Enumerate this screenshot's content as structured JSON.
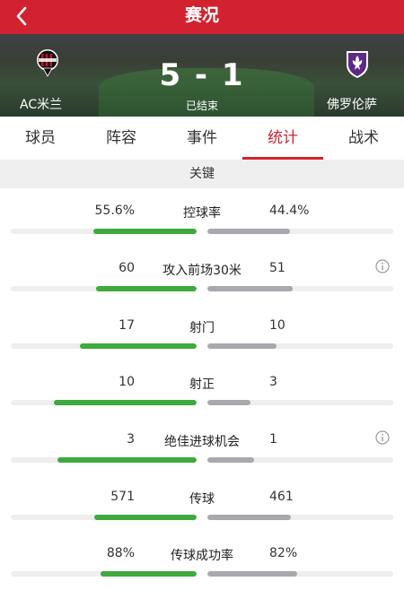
{
  "topbar": {
    "title": "赛况",
    "back_icon": "chevron-left-icon"
  },
  "match": {
    "home_team": "AC米兰",
    "away_team": "佛罗伦萨",
    "score": "5 - 1",
    "status": "已结束",
    "home_logo": "ac-milan-crest-icon",
    "away_logo": "fiorentina-crest-icon"
  },
  "tabs": [
    {
      "label": "球员"
    },
    {
      "label": "阵容"
    },
    {
      "label": "事件"
    },
    {
      "label": "统计",
      "active": true
    },
    {
      "label": "战术"
    }
  ],
  "section": {
    "title": "关键"
  },
  "stats": [
    {
      "label": "控球率",
      "home": "55.6%",
      "away": "44.4%",
      "home_ratio": 0.556,
      "away_ratio": 0.444,
      "info": false
    },
    {
      "label": "攻入前场30米",
      "home": "60",
      "away": "51",
      "home_ratio": 0.54,
      "away_ratio": 0.46,
      "info": true
    },
    {
      "label": "射门",
      "home": "17",
      "away": "10",
      "home_ratio": 0.63,
      "away_ratio": 0.37,
      "info": false
    },
    {
      "label": "射正",
      "home": "10",
      "away": "3",
      "home_ratio": 0.77,
      "away_ratio": 0.23,
      "info": false
    },
    {
      "label": "绝佳进球机会",
      "home": "3",
      "away": "1",
      "home_ratio": 0.75,
      "away_ratio": 0.25,
      "info": true
    },
    {
      "label": "传球",
      "home": "571",
      "away": "461",
      "home_ratio": 0.553,
      "away_ratio": 0.447,
      "info": false
    },
    {
      "label": "传球成功率",
      "home": "88%",
      "away": "82%",
      "home_ratio": 0.518,
      "away_ratio": 0.482,
      "info": false
    }
  ],
  "colors": {
    "brand_red": "#d3222f",
    "home_bar": "#3eaa3e",
    "away_bar": "#a8a9ad"
  }
}
